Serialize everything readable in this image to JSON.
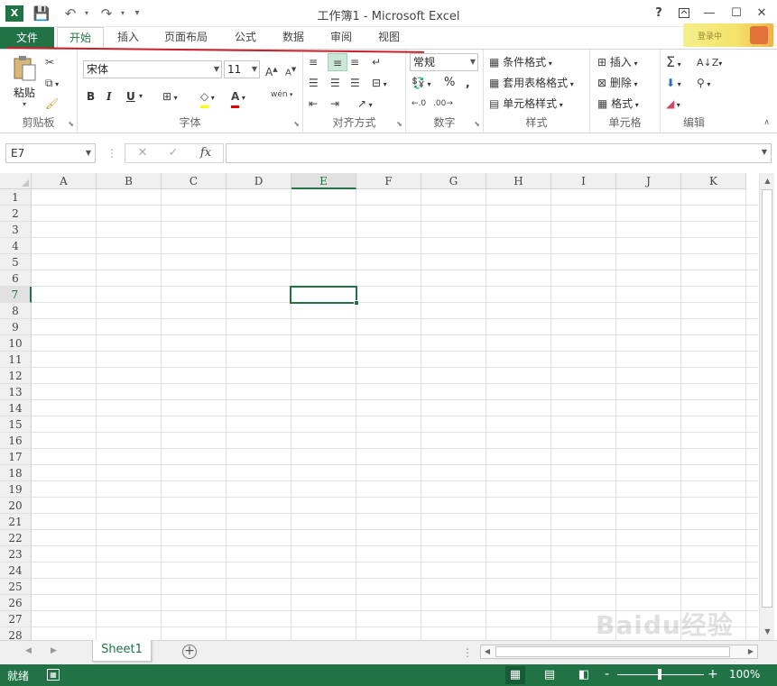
{
  "window": {
    "title": "工作簿1 - Microsoft Excel",
    "app_logo": "X",
    "help": "?",
    "restore_icon": "ribbon-display-icon",
    "minimize": "—",
    "maximize": "☐",
    "close": "✕"
  },
  "quick_access": {
    "save": "💾",
    "undo": "↶",
    "redo": "↷",
    "customize": "▾"
  },
  "tabs": {
    "file": "文件",
    "items": [
      "开始",
      "插入",
      "页面布局",
      "公式",
      "数据",
      "审阅",
      "视图"
    ],
    "active": "开始"
  },
  "account": {
    "name": "登录中"
  },
  "ribbon": {
    "clipboard": {
      "label": "剪贴板",
      "paste": "粘贴"
    },
    "font": {
      "label": "字体",
      "name": "宋体",
      "size": "11",
      "bold": "B",
      "italic": "I",
      "underline": "U",
      "phonetic": "wén"
    },
    "alignment": {
      "label": "对齐方式"
    },
    "number": {
      "label": "数字",
      "format": "常规",
      "percent": "%",
      "comma": ","
    },
    "styles": {
      "label": "样式",
      "conditional": "条件格式",
      "table": "套用表格格式",
      "cell_styles": "单元格样式"
    },
    "cells": {
      "label": "单元格",
      "insert": "插入",
      "delete": "删除",
      "format": "格式"
    },
    "editing": {
      "label": "编辑"
    }
  },
  "formula_bar": {
    "name_box": "E7",
    "cancel": "✕",
    "enter": "✓",
    "fx": "fx",
    "value": ""
  },
  "grid": {
    "columns": [
      "A",
      "B",
      "C",
      "D",
      "E",
      "F",
      "G",
      "H",
      "I",
      "J",
      "K"
    ],
    "rows": [
      "1",
      "2",
      "3",
      "4",
      "5",
      "6",
      "7",
      "8",
      "9",
      "10",
      "11",
      "12",
      "13",
      "14",
      "15",
      "16",
      "17",
      "18",
      "19",
      "20",
      "21",
      "22",
      "23",
      "24",
      "25",
      "26",
      "27",
      "28"
    ],
    "active_cell": "E7",
    "active_column": "E",
    "active_row": "7"
  },
  "sheets": {
    "tabs": [
      "Sheet1"
    ],
    "active": "Sheet1",
    "add": "+"
  },
  "status": {
    "ready": "就绪",
    "zoom": "100%",
    "zoom_minus": "-",
    "zoom_plus": "+"
  },
  "watermark": "Baidu经验"
}
